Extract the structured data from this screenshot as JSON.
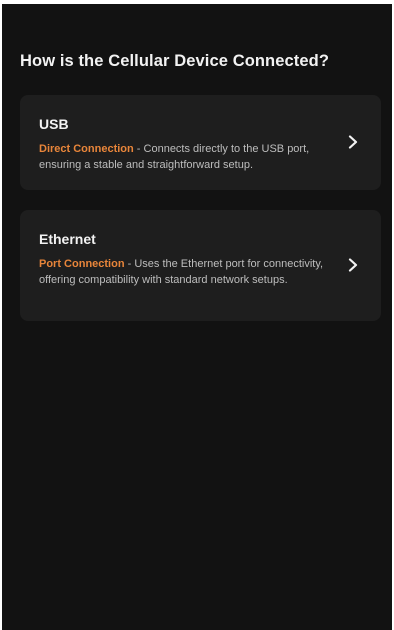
{
  "page": {
    "title": "How is the Cellular Device Connected?"
  },
  "options": [
    {
      "title": "USB",
      "highlight": "Direct Connection",
      "separator": " - ",
      "description": "Connects directly to the USB port, ensuring a stable and straightforward setup.",
      "icon": "chevron-right-icon"
    },
    {
      "title": "Ethernet",
      "highlight": "Port Connection",
      "separator": " - ",
      "description": "Uses the Ethernet port for connectivity, offering compatibility with standard network setups.",
      "icon": "chevron-right-icon"
    }
  ],
  "colors": {
    "background": "#121212",
    "card": "#1e1e1e",
    "accent": "#e8853a",
    "text": "#f2f2f2",
    "muted_text": "#bdbdbd"
  }
}
